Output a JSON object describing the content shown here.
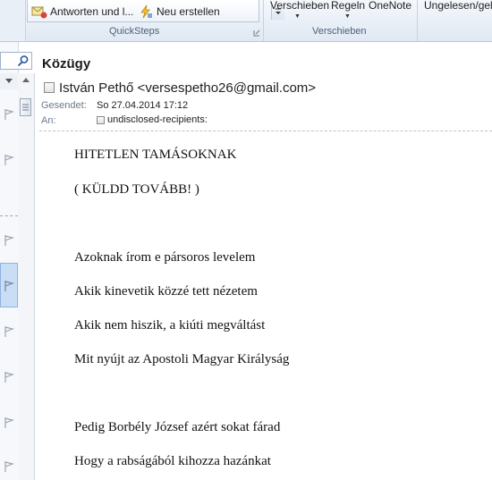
{
  "ribbon": {
    "quicksteps": {
      "reply_note_label": "Antworten und l...",
      "new_label": "Neu erstellen",
      "group_label": "QuickSteps"
    },
    "move": {
      "move_label": "Verschieben",
      "rules_label": "Regeln",
      "onenote_label": "OneNote",
      "group_label": "Verschieben"
    },
    "tags": {
      "unread_label": "Ungelesen/gele"
    }
  },
  "message": {
    "subject": "Közügy",
    "sender": "István Pethő <versespetho26@gmail.com>",
    "sent_label": "Gesendet:",
    "sent_value": "So 27.04.2014 17:12",
    "to_label": "An:",
    "to_value": "undisclosed-recipients:",
    "body": [
      "HITETLEN TAMÁSOKNAK",
      "( KÜLDD TOVÁBB! )",
      "Azoknak írom e pársoros levelem",
      "Akik kinevetik közzé tett nézetem",
      "Akik nem hiszik, a kiúti megváltást",
      "Mit nyújt az Apostoli Magyar Királyság",
      "Pedig Borbély József azért sokat fárad",
      "Hogy a rabságából kihozza hazánkat"
    ]
  }
}
